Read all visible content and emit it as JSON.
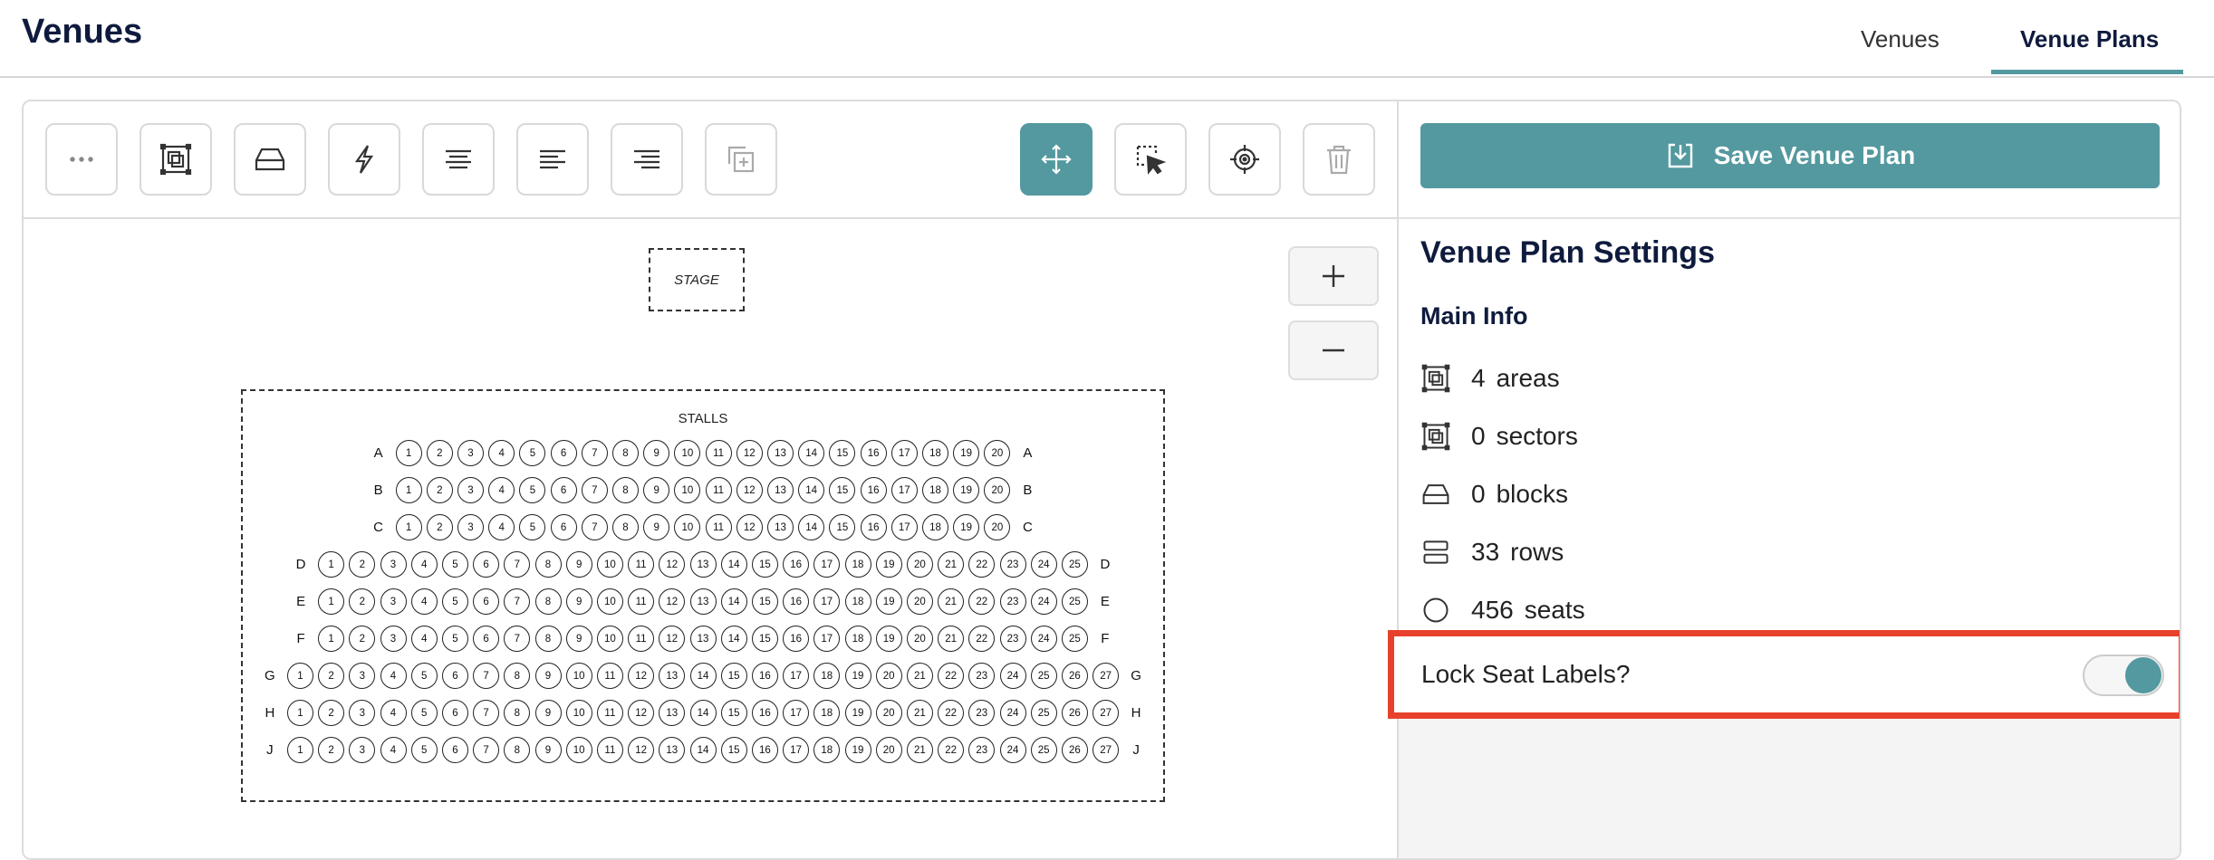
{
  "header": {
    "title": "Venues",
    "tabs": [
      {
        "label": "Venues",
        "active": false
      },
      {
        "label": "Venue Plans",
        "active": true
      }
    ]
  },
  "toolbar": {
    "tools": [
      {
        "name": "more-options",
        "icon": "ellipsis-icon",
        "state": "normal"
      },
      {
        "name": "add-area",
        "icon": "area-icon",
        "state": "normal"
      },
      {
        "name": "add-block",
        "icon": "block-icon",
        "state": "normal"
      },
      {
        "name": "quick-action",
        "icon": "lightning-icon",
        "state": "normal"
      },
      {
        "name": "align-center",
        "icon": "align-center-icon",
        "state": "normal"
      },
      {
        "name": "align-left",
        "icon": "align-left-icon",
        "state": "normal"
      },
      {
        "name": "align-right",
        "icon": "align-right-icon",
        "state": "normal"
      },
      {
        "name": "duplicate",
        "icon": "duplicate-icon",
        "state": "disabled"
      },
      {
        "name": "move",
        "icon": "move-icon",
        "state": "active"
      },
      {
        "name": "select",
        "icon": "select-cursor-icon",
        "state": "normal"
      },
      {
        "name": "center",
        "icon": "crosshair-icon",
        "state": "normal"
      },
      {
        "name": "delete",
        "icon": "trash-icon",
        "state": "disabled"
      }
    ]
  },
  "canvas": {
    "stage_label": "STAGE",
    "area_label": "STALLS",
    "zoom_in": "+",
    "zoom_out": "−",
    "rows": [
      {
        "label": "A",
        "seats": 20
      },
      {
        "label": "B",
        "seats": 20
      },
      {
        "label": "C",
        "seats": 20
      },
      {
        "label": "D",
        "seats": 25
      },
      {
        "label": "E",
        "seats": 25
      },
      {
        "label": "F",
        "seats": 25
      },
      {
        "label": "G",
        "seats": 27
      },
      {
        "label": "H",
        "seats": 27
      },
      {
        "label": "J",
        "seats": 27
      }
    ]
  },
  "sidebar": {
    "save_label": "Save Venue Plan",
    "settings_title": "Venue Plan Settings",
    "main_info_title": "Main Info",
    "stats": [
      {
        "icon": "area-icon",
        "count": "4",
        "label": "areas"
      },
      {
        "icon": "sector-icon",
        "count": "0",
        "label": "sectors"
      },
      {
        "icon": "block-icon",
        "count": "0",
        "label": "blocks"
      },
      {
        "icon": "rows-icon",
        "count": "33",
        "label": "rows"
      },
      {
        "icon": "seat-circle-icon",
        "count": "456",
        "label": "seats"
      }
    ],
    "lock_label": "Lock Seat Labels?",
    "lock_enabled": true
  },
  "colors": {
    "accent": "#53999f",
    "highlight": "#e8412b",
    "heading": "#0f1b3d"
  }
}
